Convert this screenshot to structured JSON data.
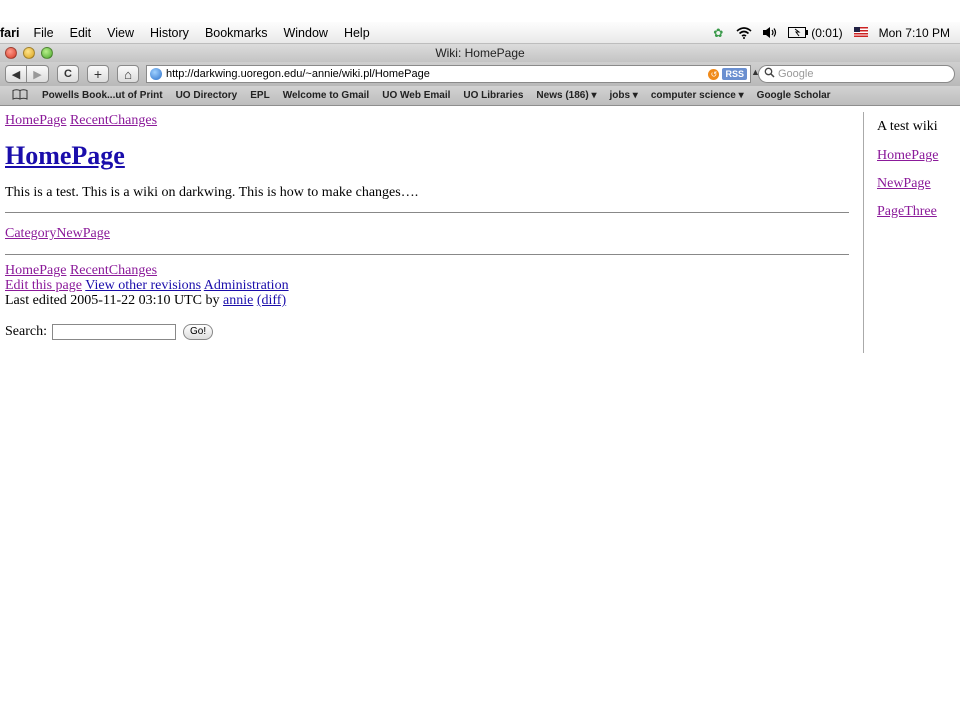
{
  "menubar": {
    "app_name": "fari",
    "menus": [
      "File",
      "Edit",
      "View",
      "History",
      "Bookmarks",
      "Window",
      "Help"
    ],
    "battery_text": "(0:01)",
    "clock": "Mon 7:10 PM"
  },
  "window": {
    "title": "Wiki: HomePage"
  },
  "toolbar": {
    "back_icon": "◀",
    "forward_icon": "▶",
    "reload_icon": "C",
    "add_icon": "+",
    "home_icon": "⌂",
    "url": "http://darkwing.uoregon.edu/~annie/wiki.pl/HomePage",
    "rss_label": "RSS",
    "search_placeholder": "Google"
  },
  "bookmarks": {
    "items": [
      "Powells Book...ut of Print",
      "UO Directory",
      "EPL",
      "Welcome to Gmail",
      "UO Web Email",
      "UO Libraries",
      "News (186) ▾",
      "jobs ▾",
      "computer science ▾",
      "Google Scholar"
    ]
  },
  "page": {
    "top_links": [
      "HomePage",
      "RecentChanges"
    ],
    "title": "HomePage",
    "body": "This is a test. This is a wiki on darkwing. This is how to make changes….",
    "category_link": "CategoryNewPage",
    "footer": {
      "links": [
        "HomePage",
        "RecentChanges"
      ],
      "edit_link": "Edit this page",
      "revisions_link": "View other revisions",
      "admin_link": "Administration",
      "last_edited_prefix": "Last edited 2005-11-22 03:10 UTC by",
      "author": "annie",
      "diff": "(diff)"
    },
    "search_label": "Search:",
    "go_label": "Go!"
  },
  "sidebar": {
    "title": "A test wiki",
    "links": [
      "HomePage",
      "NewPage",
      "PageThree"
    ]
  }
}
